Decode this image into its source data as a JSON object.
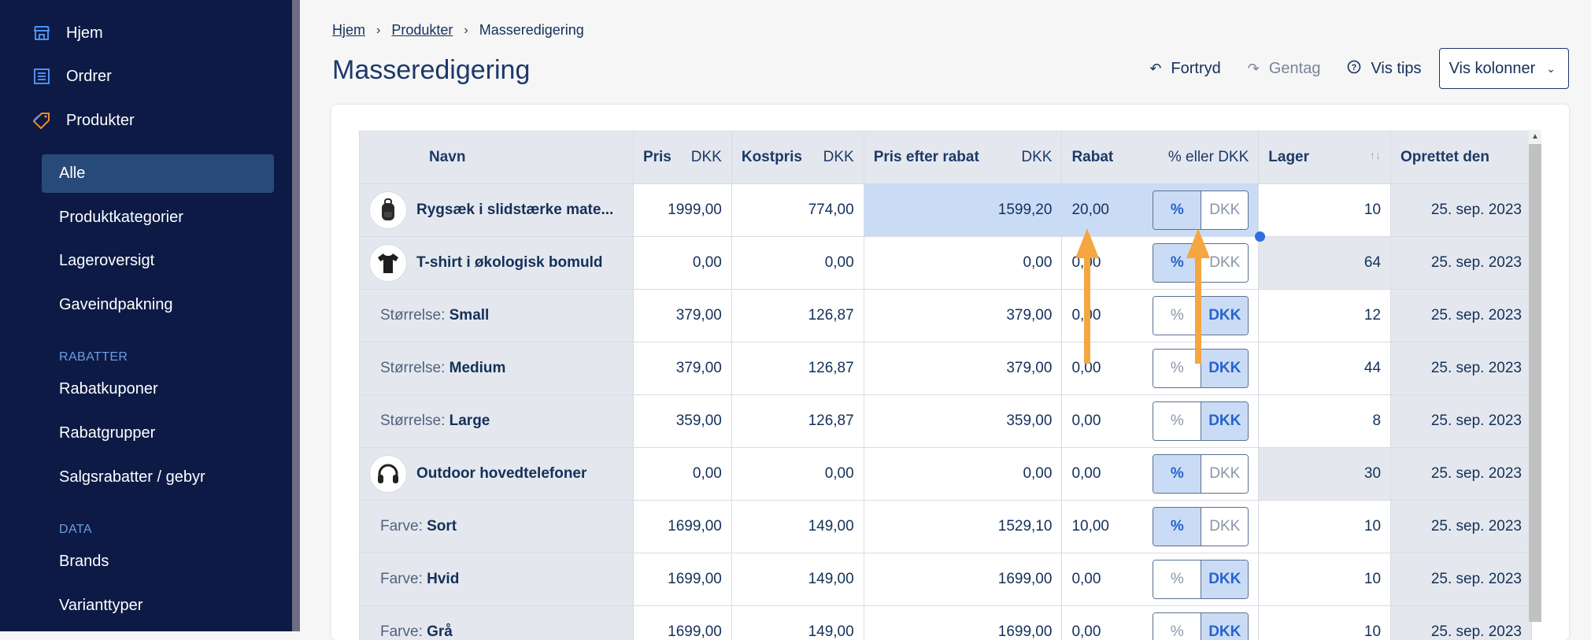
{
  "sidebar": {
    "top": [
      {
        "label": "Hjem",
        "icon": "store-icon"
      },
      {
        "label": "Ordrer",
        "icon": "orders-list-icon"
      },
      {
        "label": "Produkter",
        "icon": "tag-icon"
      }
    ],
    "produkter_sub": [
      {
        "label": "Alle",
        "active": true
      },
      {
        "label": "Produktkategorier"
      },
      {
        "label": "Lageroversigt"
      },
      {
        "label": "Gaveindpakning"
      }
    ],
    "rabatter_title": "RABATTER",
    "rabatter_items": [
      "Rabatkuponer",
      "Rabatgrupper",
      "Salgsrabatter / gebyr"
    ],
    "data_title": "DATA",
    "data_items": [
      "Brands",
      "Varianttyper"
    ]
  },
  "breadcrumb": {
    "home": "Hjem",
    "products": "Produkter",
    "current": "Masseredigering"
  },
  "page_title": "Masseredigering",
  "toolbar": {
    "undo": "Fortryd",
    "redo": "Gentag",
    "tips": "Vis tips",
    "columns": "Vis kolonner"
  },
  "table": {
    "headers": {
      "navn": "Navn",
      "pris": "Pris",
      "pris_unit": "DKK",
      "kostpris": "Kostpris",
      "kostpris_unit": "DKK",
      "pris_rabat": "Pris efter rabat",
      "pris_rabat_unit": "DKK",
      "rabat": "Rabat",
      "rabat_unit": "% eller DKK",
      "lager": "Lager",
      "lager_sort": "↑↓",
      "oprettet": "Oprettet den"
    },
    "toggle_labels": {
      "percent": "%",
      "dkk": "DKK"
    },
    "rows": [
      {
        "prefix": "",
        "name": "Rygsæk i slidstærke mate...",
        "avatar": "backpack",
        "pris": "1999,00",
        "kostpris": "774,00",
        "pris_rabat": "1599,20",
        "rabat": "20,00",
        "mode": "%",
        "lager": "10",
        "oprettet": "25. sep. 2023"
      },
      {
        "prefix": "",
        "name": "T-shirt i økologisk bomuld",
        "avatar": "tshirt",
        "pris": "0,00",
        "kostpris": "0,00",
        "pris_rabat": "0,00",
        "rabat": "0,00",
        "mode": "%",
        "lager": "64",
        "oprettet": "25. sep. 2023"
      },
      {
        "prefix": "Størrelse: ",
        "name": "Small",
        "avatar": "",
        "pris": "379,00",
        "kostpris": "126,87",
        "pris_rabat": "379,00",
        "rabat": "0,00",
        "mode": "DKK",
        "lager": "12",
        "oprettet": "25. sep. 2023"
      },
      {
        "prefix": "Størrelse: ",
        "name": "Medium",
        "avatar": "",
        "pris": "379,00",
        "kostpris": "126,87",
        "pris_rabat": "379,00",
        "rabat": "0,00",
        "mode": "DKK",
        "lager": "44",
        "oprettet": "25. sep. 2023"
      },
      {
        "prefix": "Størrelse: ",
        "name": "Large",
        "avatar": "",
        "pris": "359,00",
        "kostpris": "126,87",
        "pris_rabat": "359,00",
        "rabat": "0,00",
        "mode": "DKK",
        "lager": "8",
        "oprettet": "25. sep. 2023"
      },
      {
        "prefix": "",
        "name": "Outdoor hovedtelefoner",
        "avatar": "headphones",
        "pris": "0,00",
        "kostpris": "0,00",
        "pris_rabat": "0,00",
        "rabat": "0,00",
        "mode": "%",
        "lager": "30",
        "oprettet": "25. sep. 2023"
      },
      {
        "prefix": "Farve: ",
        "name": "Sort",
        "avatar": "",
        "pris": "1699,00",
        "kostpris": "149,00",
        "pris_rabat": "1529,10",
        "rabat": "10,00",
        "mode": "%",
        "lager": "10",
        "oprettet": "25. sep. 2023"
      },
      {
        "prefix": "Farve: ",
        "name": "Hvid",
        "avatar": "",
        "pris": "1699,00",
        "kostpris": "149,00",
        "pris_rabat": "1699,00",
        "rabat": "0,00",
        "mode": "DKK",
        "lager": "10",
        "oprettet": "25. sep. 2023"
      },
      {
        "prefix": "Farve: ",
        "name": "Grå",
        "avatar": "",
        "pris": "1699,00",
        "kostpris": "149,00",
        "pris_rabat": "1699,00",
        "rabat": "0,00",
        "mode": "DKK",
        "lager": "10",
        "oprettet": "25. sep. 2023"
      }
    ]
  },
  "colors": {
    "sidebar_bg": "#0c1a45",
    "accent": "#2862cc",
    "annotation_arrow": "#f5a640",
    "highlight": "#cadcf5"
  }
}
